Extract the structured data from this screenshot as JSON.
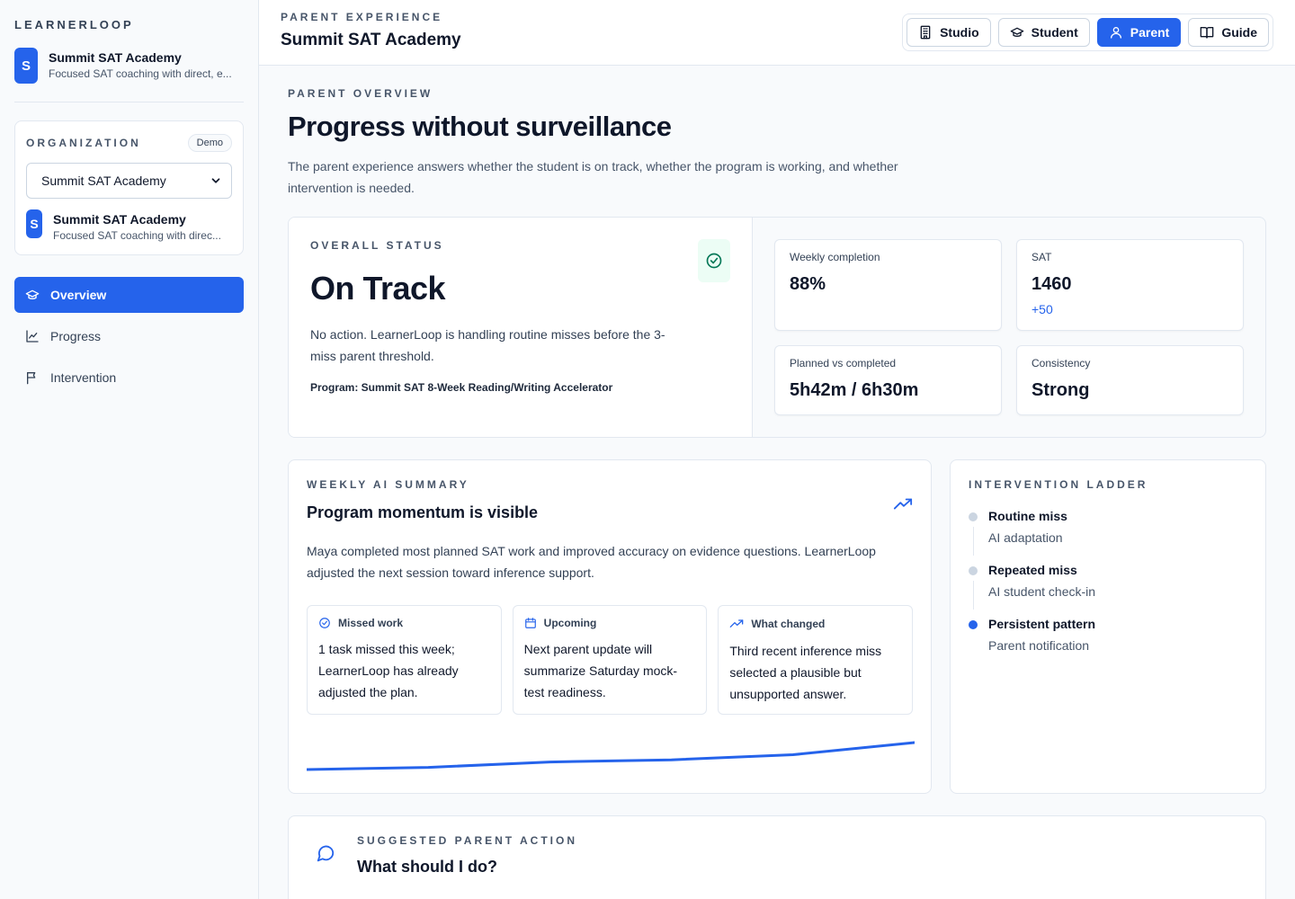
{
  "sidebar": {
    "brand": "LEARNERLOOP",
    "org": {
      "initial": "S",
      "name": "Summit SAT Academy",
      "desc": "Focused SAT coaching with direct, e..."
    },
    "org_card": {
      "label": "ORGANIZATION",
      "badge": "Demo",
      "select_value": "Summit SAT Academy",
      "mini": {
        "initial": "S",
        "name": "Summit SAT Academy",
        "desc": "Focused SAT coaching with direc..."
      }
    },
    "nav": [
      {
        "label": "Overview",
        "icon": "graduation-cap-icon"
      },
      {
        "label": "Progress",
        "icon": "line-chart-icon"
      },
      {
        "label": "Intervention",
        "icon": "flag-icon"
      }
    ]
  },
  "header": {
    "eyebrow": "PARENT EXPERIENCE",
    "title": "Summit SAT Academy",
    "modes": [
      {
        "label": "Studio",
        "icon": "building-icon"
      },
      {
        "label": "Student",
        "icon": "graduation-cap-icon"
      },
      {
        "label": "Parent",
        "icon": "user-icon"
      },
      {
        "label": "Guide",
        "icon": "book-icon"
      }
    ],
    "active_mode": "Parent"
  },
  "main": {
    "eyebrow": "PARENT OVERVIEW",
    "title": "Progress without surveillance",
    "subtitle": "The parent experience answers whether the student is on track, whether the program is working, and whether intervention is needed.",
    "status": {
      "label": "OVERALL STATUS",
      "value": "On Track",
      "text": "No action. LearnerLoop is handling routine misses before the 3-miss parent threshold.",
      "program": "Program: Summit SAT 8-Week Reading/Writing Accelerator"
    },
    "metrics": [
      {
        "label": "Weekly completion",
        "value": "88%",
        "delta": ""
      },
      {
        "label": "SAT",
        "value": "1460",
        "delta": "+50"
      },
      {
        "label": "Planned vs completed",
        "value": "5h42m / 6h30m",
        "delta": ""
      },
      {
        "label": "Consistency",
        "value": "Strong",
        "delta": ""
      }
    ],
    "summary": {
      "label": "WEEKLY AI SUMMARY",
      "title": "Program momentum is visible",
      "text": "Maya completed most planned SAT work and improved accuracy on evidence questions. LearnerLoop adjusted the next session toward inference support.",
      "cards": [
        {
          "label": "Missed work",
          "icon": "check-circle-icon",
          "text": "1 task missed this week; LearnerLoop has already adjusted the plan."
        },
        {
          "label": "Upcoming",
          "icon": "calendar-icon",
          "text": "Next parent update will summarize Saturday mock-test readiness."
        },
        {
          "label": "What changed",
          "icon": "trend-up-icon",
          "text": "Third recent inference miss selected a plausible but unsupported answer."
        }
      ],
      "trend": [
        0.0,
        0.08,
        0.28,
        0.36,
        0.55,
        1.0
      ]
    },
    "ladder": {
      "label": "INTERVENTION LADDER",
      "steps": [
        {
          "title": "Routine miss",
          "sub": "AI adaptation",
          "active": false
        },
        {
          "title": "Repeated miss",
          "sub": "AI student check-in",
          "active": false
        },
        {
          "title": "Persistent pattern",
          "sub": "Parent notification",
          "active": true
        }
      ]
    },
    "action": {
      "label": "SUGGESTED PARENT ACTION",
      "title": "What should I do?"
    }
  },
  "colors": {
    "accent": "#2563eb",
    "success": "#047857",
    "success_bg": "#ecfdf5"
  }
}
